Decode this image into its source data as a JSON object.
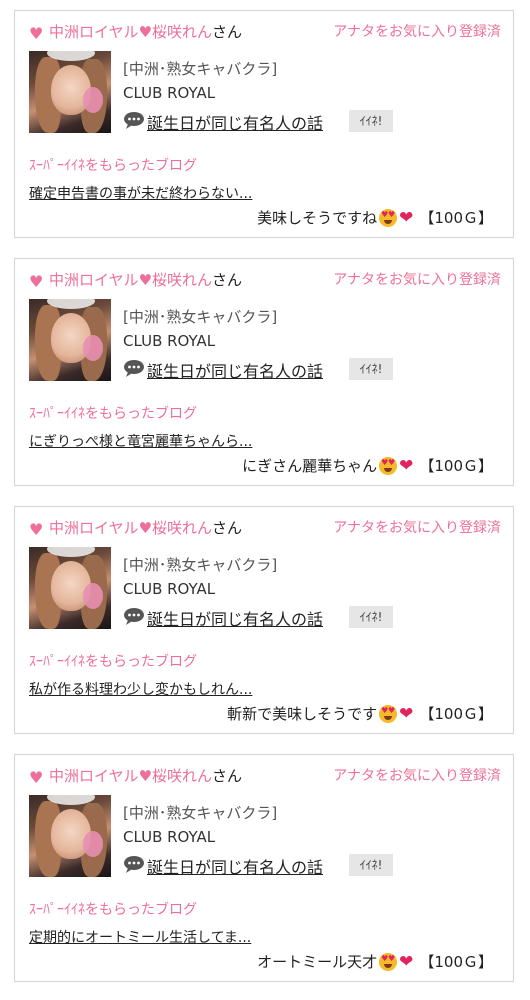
{
  "colors": {
    "accent_pink": "#ee6f97",
    "heart_red": "#e0245e",
    "button_gray": "#e6e6e6",
    "border": "#d4d4d4"
  },
  "cards": [
    {
      "cast_head_heart": "♥",
      "cast_shop_part": "中洲ロイヤル",
      "cast_mid_heart": "♥",
      "cast_person": "桜咲れん",
      "cast_suffix": "さん",
      "fav_status": "アナタをお気に入り登録済",
      "shop_category": "[中洲･熟女キャバクラ]",
      "shop_name": "CLUB ROYAL",
      "blog_title": "誕生日が同じ有名人の話",
      "iine_label": "ｲｲﾈ!",
      "super_label": "ｽｰﾊﾟｰｲｲﾈをもらったブログ",
      "entry_title": "確定申告書の事が未だ終わらない...",
      "comment": "美味しそうですね",
      "points": "【100Ｇ】"
    },
    {
      "cast_head_heart": "♥",
      "cast_shop_part": "中洲ロイヤル",
      "cast_mid_heart": "♥",
      "cast_person": "桜咲れん",
      "cast_suffix": "さん",
      "fav_status": "アナタをお気に入り登録済",
      "shop_category": "[中洲･熟女キャバクラ]",
      "shop_name": "CLUB ROYAL",
      "blog_title": "誕生日が同じ有名人の話",
      "iine_label": "ｲｲﾈ!",
      "super_label": "ｽｰﾊﾟｰｲｲﾈをもらったブログ",
      "entry_title": "にぎりっぺ様と竜宮麗華ちゃんら...",
      "comment": "にぎさん麗華ちゃん",
      "points": "【100Ｇ】"
    },
    {
      "cast_head_heart": "♥",
      "cast_shop_part": "中洲ロイヤル",
      "cast_mid_heart": "♥",
      "cast_person": "桜咲れん",
      "cast_suffix": "さん",
      "fav_status": "アナタをお気に入り登録済",
      "shop_category": "[中洲･熟女キャバクラ]",
      "shop_name": "CLUB ROYAL",
      "blog_title": "誕生日が同じ有名人の話",
      "iine_label": "ｲｲﾈ!",
      "super_label": "ｽｰﾊﾟｰｲｲﾈをもらったブログ",
      "entry_title": "私が作る料理わ少し変かもしれん...",
      "comment": "斬新で美味しそうです",
      "points": "【100Ｇ】"
    },
    {
      "cast_head_heart": "♥",
      "cast_shop_part": "中洲ロイヤル",
      "cast_mid_heart": "♥",
      "cast_person": "桜咲れん",
      "cast_suffix": "さん",
      "fav_status": "アナタをお気に入り登録済",
      "shop_category": "[中洲･熟女キャバクラ]",
      "shop_name": "CLUB ROYAL",
      "blog_title": "誕生日が同じ有名人の話",
      "iine_label": "ｲｲﾈ!",
      "super_label": "ｽｰﾊﾟｰｲｲﾈをもらったブログ",
      "entry_title": "定期的にオートミール生活してま...",
      "comment": "オートミール天才",
      "points": "【100Ｇ】"
    }
  ],
  "icons": {
    "heart": "heart-icon",
    "chat": "chat-bubble-icon",
    "emoji": "heart-eyes-emoji-icon",
    "red_heart": "red-heart-emoji-icon"
  }
}
